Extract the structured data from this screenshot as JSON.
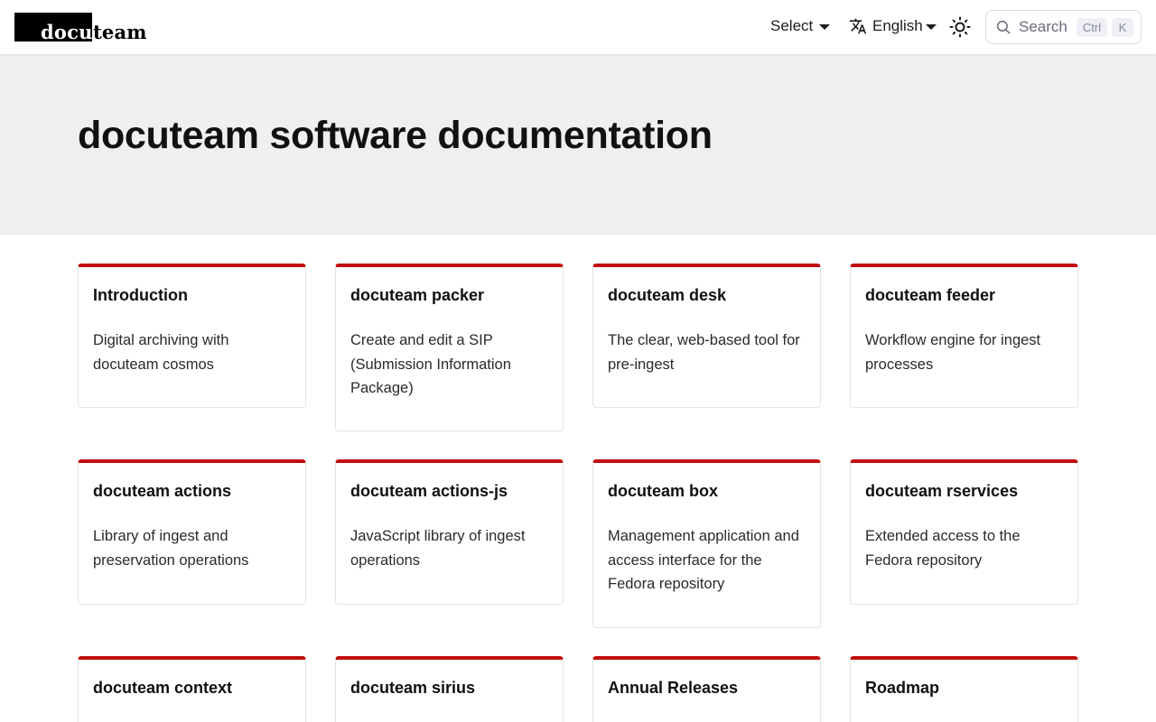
{
  "header": {
    "logo_inverted": "docu",
    "logo_rest": "team",
    "select_label": "Select",
    "language_label": "English",
    "search_label": "Search",
    "search_kbd_ctrl": "Ctrl",
    "search_kbd_k": "K"
  },
  "hero": {
    "title": "docuteam software documentation"
  },
  "cards": [
    {
      "title": "Introduction",
      "description": "Digital archiving with docuteam cosmos"
    },
    {
      "title": "docuteam packer",
      "description": "Create and edit a SIP (Submission Information Package)"
    },
    {
      "title": "docuteam desk",
      "description": "The clear, web-based tool for pre-ingest"
    },
    {
      "title": "docuteam feeder",
      "description": "Workflow engine for ingest processes"
    },
    {
      "title": "docuteam actions",
      "description": "Library of ingest and preservation operations"
    },
    {
      "title": "docuteam actions-js",
      "description": "JavaScript library of ingest operations"
    },
    {
      "title": "docuteam box",
      "description": "Management application and access interface for the Fedora repository"
    },
    {
      "title": "docuteam rservices",
      "description": "Extended access to the Fedora repository"
    },
    {
      "title": "docuteam context",
      "description": ""
    },
    {
      "title": "docuteam sirius",
      "description": ""
    },
    {
      "title": "Annual Releases",
      "description": ""
    },
    {
      "title": "Roadmap",
      "description": ""
    }
  ],
  "colors": {
    "accent": "#c00f0f",
    "hero_bg": "#efefef"
  }
}
